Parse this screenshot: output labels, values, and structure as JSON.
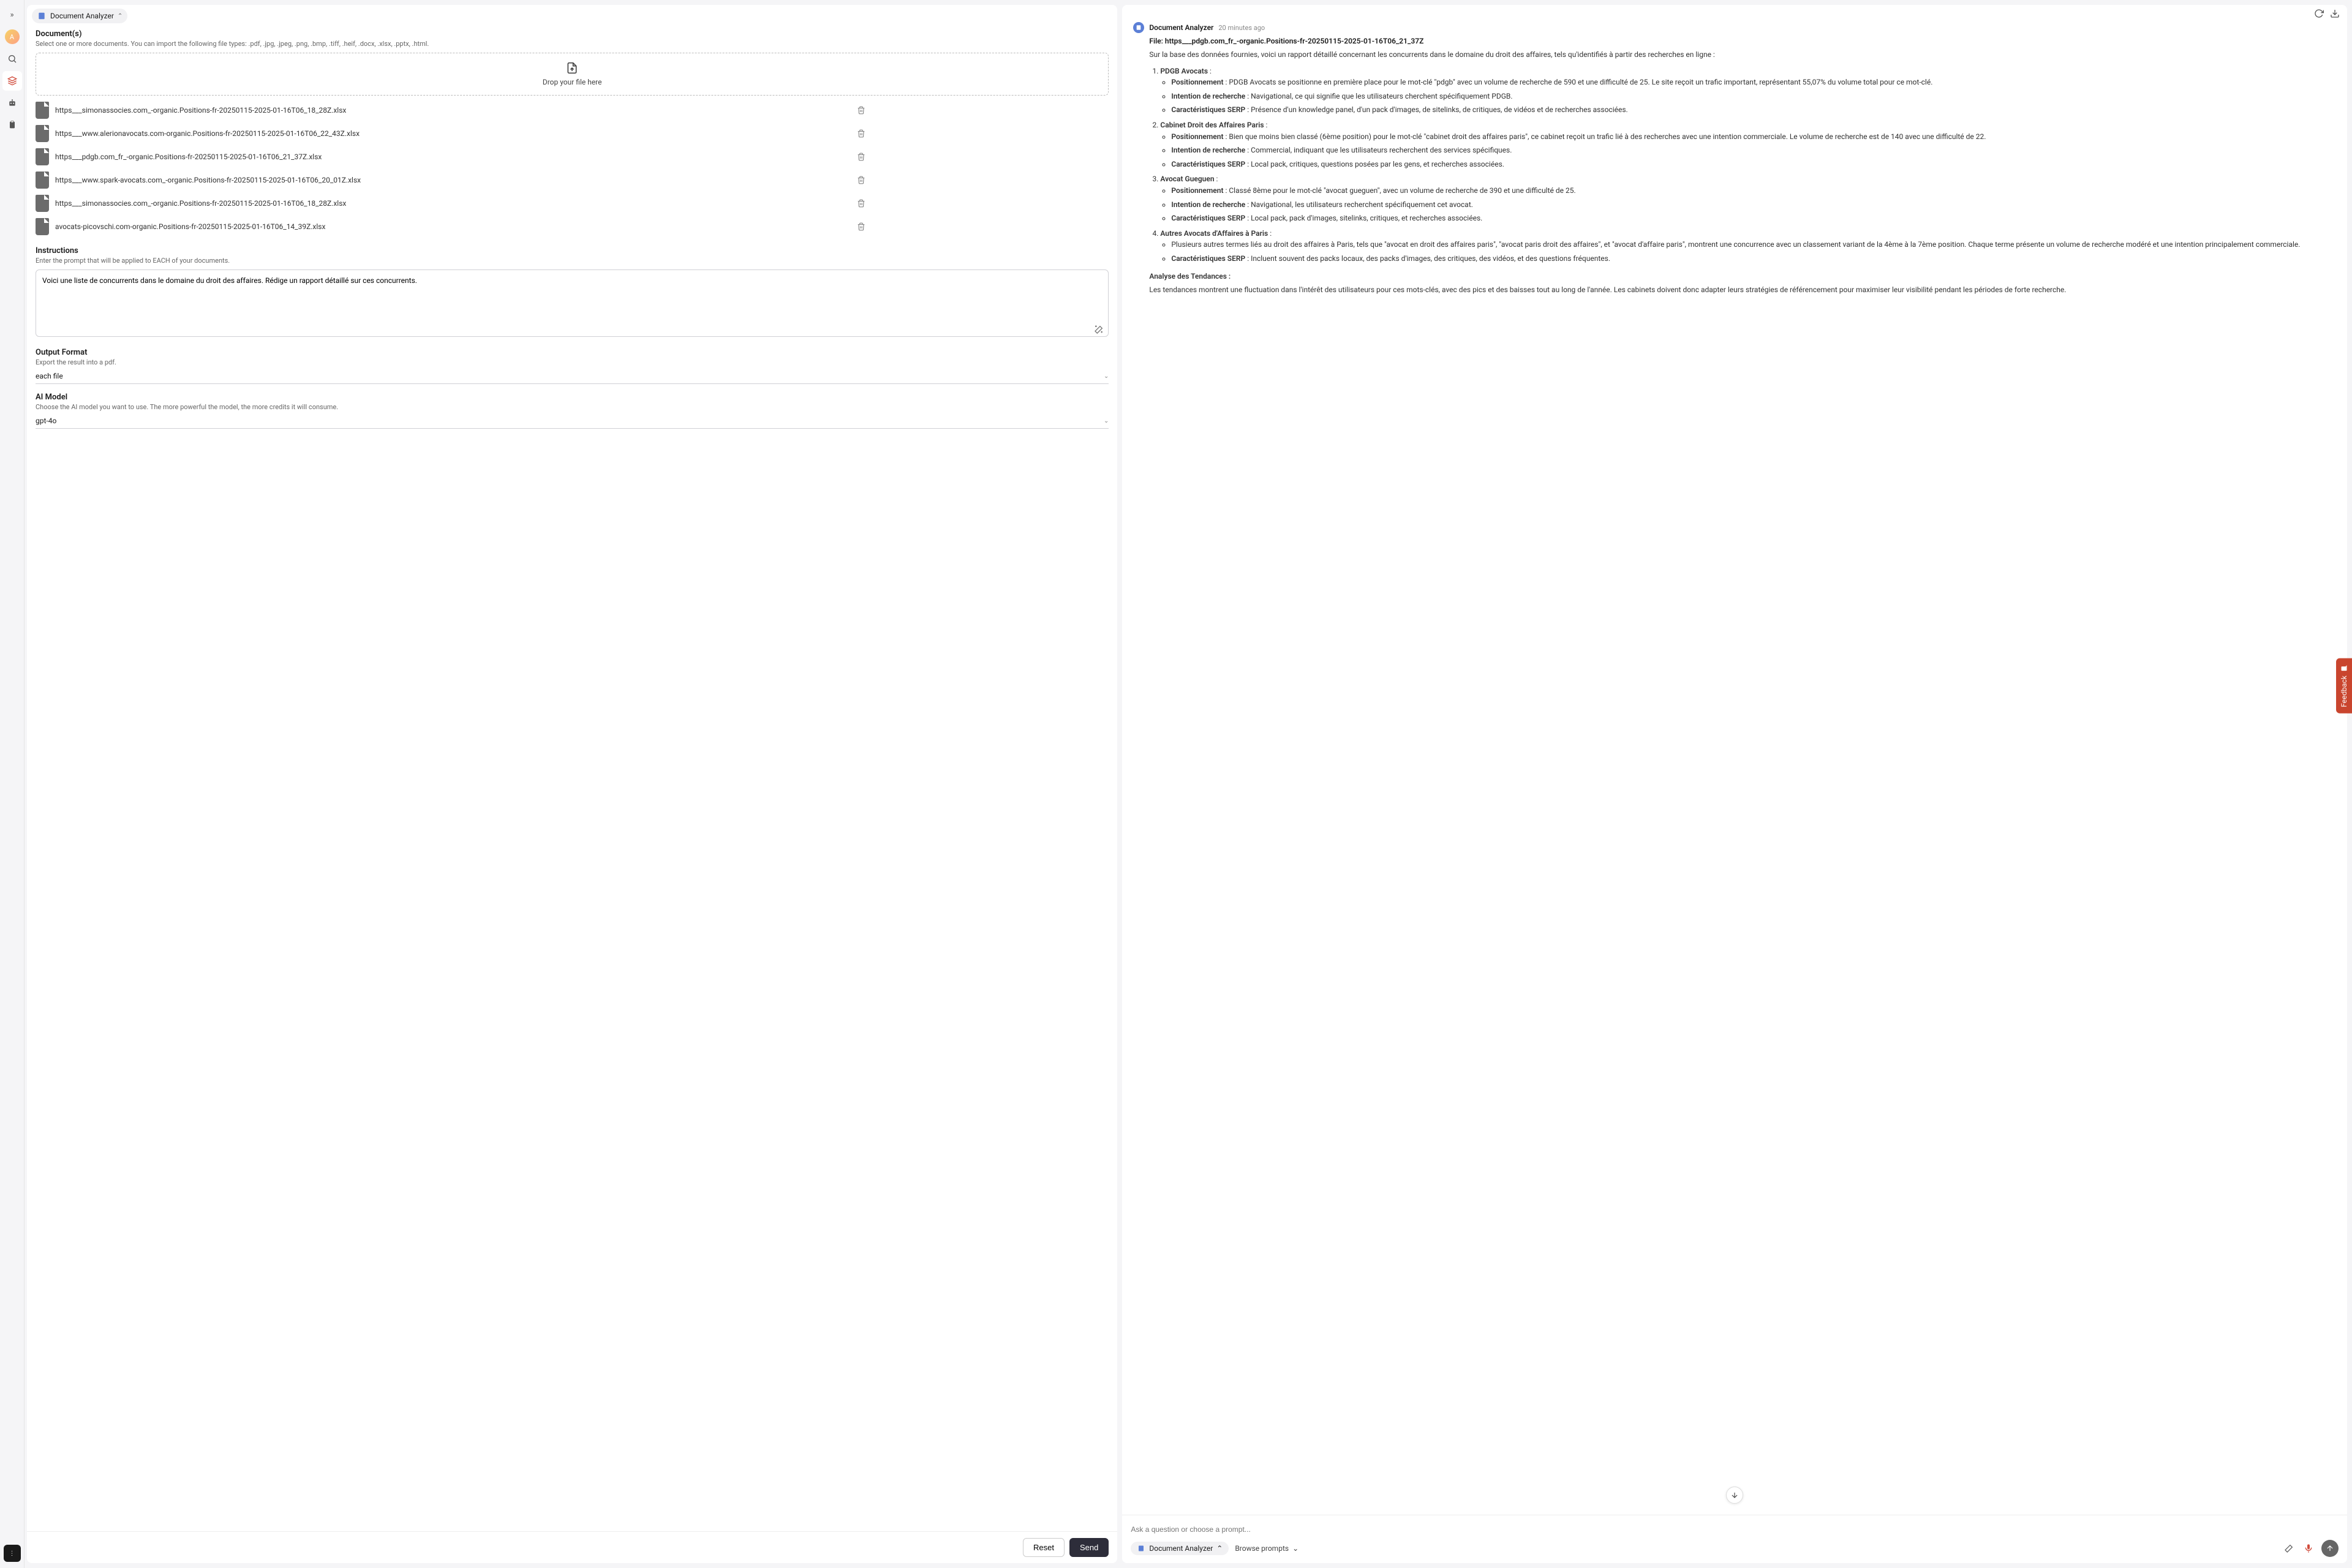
{
  "rail": {
    "expand_label": "»"
  },
  "header": {
    "app_name": "Document Analyzer"
  },
  "documents": {
    "title": "Document(s)",
    "subtitle": "Select one or more documents. You can import the following file types: .pdf, .jpg, .jpeg, .png, .bmp, .tiff, .heif, .docx, .xlsx, .pptx, .html.",
    "dropzone_label": "Drop your file here",
    "files": [
      "https___simonassocies.com_-organic.Positions-fr-20250115-2025-01-16T06_18_28Z.xlsx",
      "https___www.alerionavocats.com-organic.Positions-fr-20250115-2025-01-16T06_22_43Z.xlsx",
      "https___pdgb.com_fr_-organic.Positions-fr-20250115-2025-01-16T06_21_37Z.xlsx",
      "https___www.spark-avocats.com_-organic.Positions-fr-20250115-2025-01-16T06_20_01Z.xlsx",
      "https___simonassocies.com_-organic.Positions-fr-20250115-2025-01-16T06_18_28Z.xlsx",
      "avocats-picovschi.com-organic.Positions-fr-20250115-2025-01-16T06_14_39Z.xlsx"
    ]
  },
  "instructions": {
    "title": "Instructions",
    "subtitle": "Enter the prompt that will be applied to EACH of your documents.",
    "value": "Voici une liste de concurrents dans le domaine du droit des affaires. Rédige un rapport détaillé sur ces concurrents."
  },
  "output_format": {
    "title": "Output Format",
    "subtitle": "Export the result into a pdf.",
    "value": "each file"
  },
  "ai_model": {
    "title": "AI Model",
    "subtitle": "Choose the AI model you want to use. The more powerful the model, the more credits it will consume.",
    "value": "gpt-4o"
  },
  "buttons": {
    "reset": "Reset",
    "send": "Send"
  },
  "chat": {
    "sender": "Document Analyzer",
    "timestamp": "20 minutes ago",
    "file_label": "File: https___pdgb.com_fr_-organic.Positions-fr-20250115-2025-01-16T06_21_37Z",
    "intro": "Sur la base des données fournies, voici un rapport détaillé concernant les concurrents dans le domaine du droit des affaires, tels qu'identifiés à partir des recherches en ligne :",
    "items": [
      {
        "title": "PDGB Avocats",
        "bullets": [
          {
            "label": "Positionnement",
            "text": " : PDGB Avocats se positionne en première place pour le mot-clé \"pdgb\" avec un volume de recherche de 590 et une difficulté de 25. Le site reçoit un trafic important, représentant 55,07% du volume total pour ce mot-clé."
          },
          {
            "label": "Intention de recherche",
            "text": " : Navigational, ce qui signifie que les utilisateurs cherchent spécifiquement PDGB."
          },
          {
            "label": "Caractéristiques SERP",
            "text": " : Présence d'un knowledge panel, d'un pack d'images, de sitelinks, de critiques, de vidéos et de recherches associées."
          }
        ]
      },
      {
        "title": "Cabinet Droit des Affaires Paris",
        "bullets": [
          {
            "label": "Positionnement",
            "text": " : Bien que moins bien classé (6ème position) pour le mot-clé \"cabinet droit des affaires paris\", ce cabinet reçoit un trafic lié à des recherches avec une intention commerciale. Le volume de recherche est de 140 avec une difficulté de 22."
          },
          {
            "label": "Intention de recherche",
            "text": " : Commercial, indiquant que les utilisateurs recherchent des services spécifiques."
          },
          {
            "label": "Caractéristiques SERP",
            "text": " : Local pack, critiques, questions posées par les gens, et recherches associées."
          }
        ]
      },
      {
        "title": "Avocat Gueguen",
        "bullets": [
          {
            "label": "Positionnement",
            "text": " : Classé 8ème pour le mot-clé \"avocat gueguen\", avec un volume de recherche de 390 et une difficulté de 25."
          },
          {
            "label": "Intention de recherche",
            "text": " : Navigational, les utilisateurs recherchent spécifiquement cet avocat."
          },
          {
            "label": "Caractéristiques SERP",
            "text": " : Local pack, pack d'images, sitelinks, critiques, et recherches associées."
          }
        ]
      },
      {
        "title": "Autres Avocats d'Affaires à Paris",
        "bullets": [
          {
            "label": "",
            "text": "Plusieurs autres termes liés au droit des affaires à Paris, tels que \"avocat en droit des affaires paris\", \"avocat paris droit des affaires\", et \"avocat d'affaire paris\", montrent une concurrence avec un classement variant de la 4ème à la 7ème position. Chaque terme présente un volume de recherche modéré et une intention principalement commerciale."
          },
          {
            "label": "Caractéristiques SERP",
            "text": " : Incluent souvent des packs locaux, des packs d'images, des critiques, des vidéos, et des questions fréquentes."
          }
        ]
      }
    ],
    "trends_title": "Analyse des Tendances :",
    "trends_text": "Les tendances montrent une fluctuation dans l'intérêt des utilisateurs pour ces mots-clés, avec des pics et des baisses tout au long de l'année. Les cabinets doivent donc adapter leurs stratégies de référencement pour maximiser leur visibilité pendant les périodes de forte recherche."
  },
  "composer": {
    "placeholder": "Ask a question or choose a prompt...",
    "chip_label": "Document Analyzer",
    "browse_label": "Browse prompts"
  },
  "feedback": "Feedback"
}
